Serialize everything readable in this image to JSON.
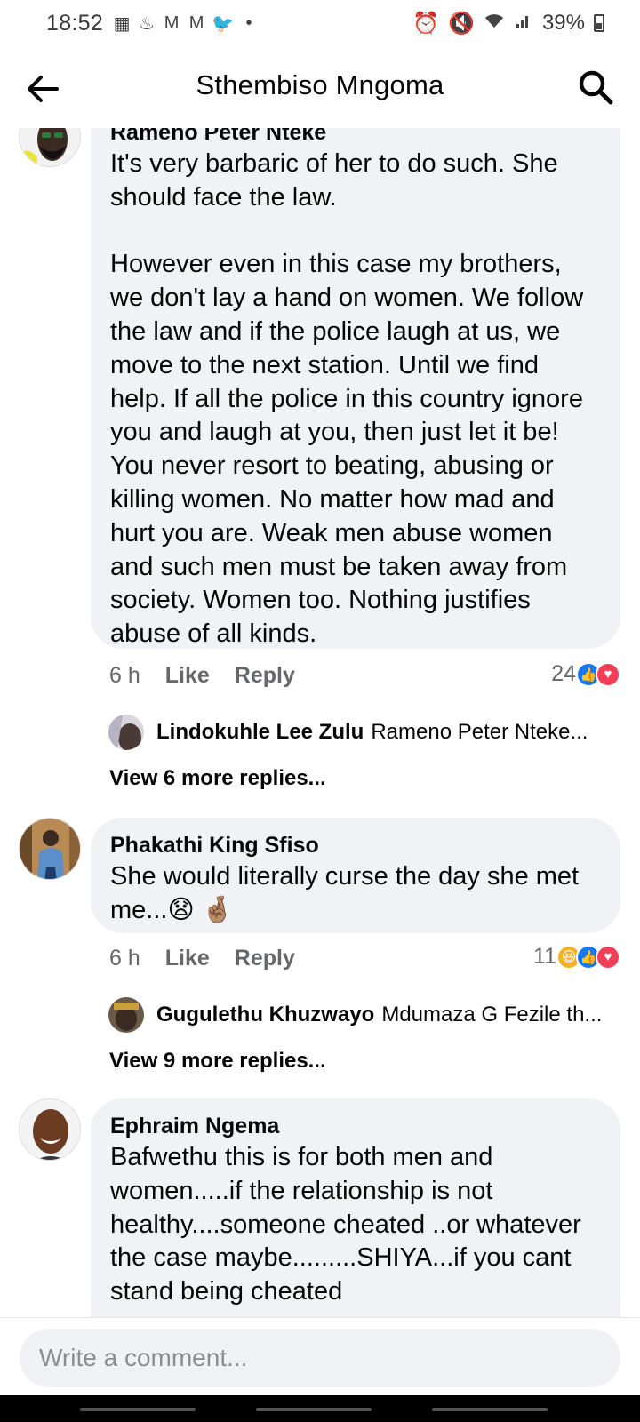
{
  "status_bar": {
    "time": "18:52",
    "left_icons": [
      "teams-icon",
      "notification-icon",
      "gmail-icon",
      "gmail-icon",
      "twitter-icon",
      "dot-icon"
    ],
    "right_icons": [
      "alarm-icon",
      "mute-icon",
      "wifi-icon",
      "signal-icon"
    ],
    "battery": "39%"
  },
  "header": {
    "title": "Sthembiso Mngoma"
  },
  "comments": [
    {
      "author": "Rameno Peter Nteke",
      "text": "It's very barbaric of her to do such. She should face the law.\n\nHowever even in this case my brothers, we don't lay a hand on women. We follow the law and if the police laugh at us, we move to the next station. Until we find help. If all the police in this country ignore you and laugh at you, then just let it be! You never resort to beating, abusing or killing women. No matter how mad and hurt you are. Weak men abuse women and such men must be taken away from society. Women too. Nothing justifies abuse of all kinds.",
      "time": "6 h",
      "like": "Like",
      "reply": "Reply",
      "reaction_count": "24",
      "reply_preview": {
        "name": "Lindokuhle Lee Zulu",
        "snippet": "Rameno Peter Nteke..."
      },
      "view_more": "View 6 more replies..."
    },
    {
      "author": "Phakathi King Sfiso",
      "text": "She would literally curse the day she met me...😧 🤞🏽",
      "time": "6 h",
      "like": "Like",
      "reply": "Reply",
      "reaction_count": "11",
      "reply_preview": {
        "name": "Gugulethu Khuzwayo",
        "snippet": "Mdumaza G Fezile th..."
      },
      "view_more": "View 9 more replies..."
    },
    {
      "author": "Ephraim Ngema",
      "text": "Bafwethu this is for both men and women.....if the relationship is not healthy....someone cheated ..or whatever the case maybe.........SHIYA...if you cant stand being cheated"
    }
  ],
  "composer": {
    "placeholder": "Write a comment..."
  },
  "colors": {
    "bubble": "#f0f2f5",
    "like_blue": "#1877f2",
    "love_red": "#f33e58",
    "meta_gray": "#65676b"
  }
}
